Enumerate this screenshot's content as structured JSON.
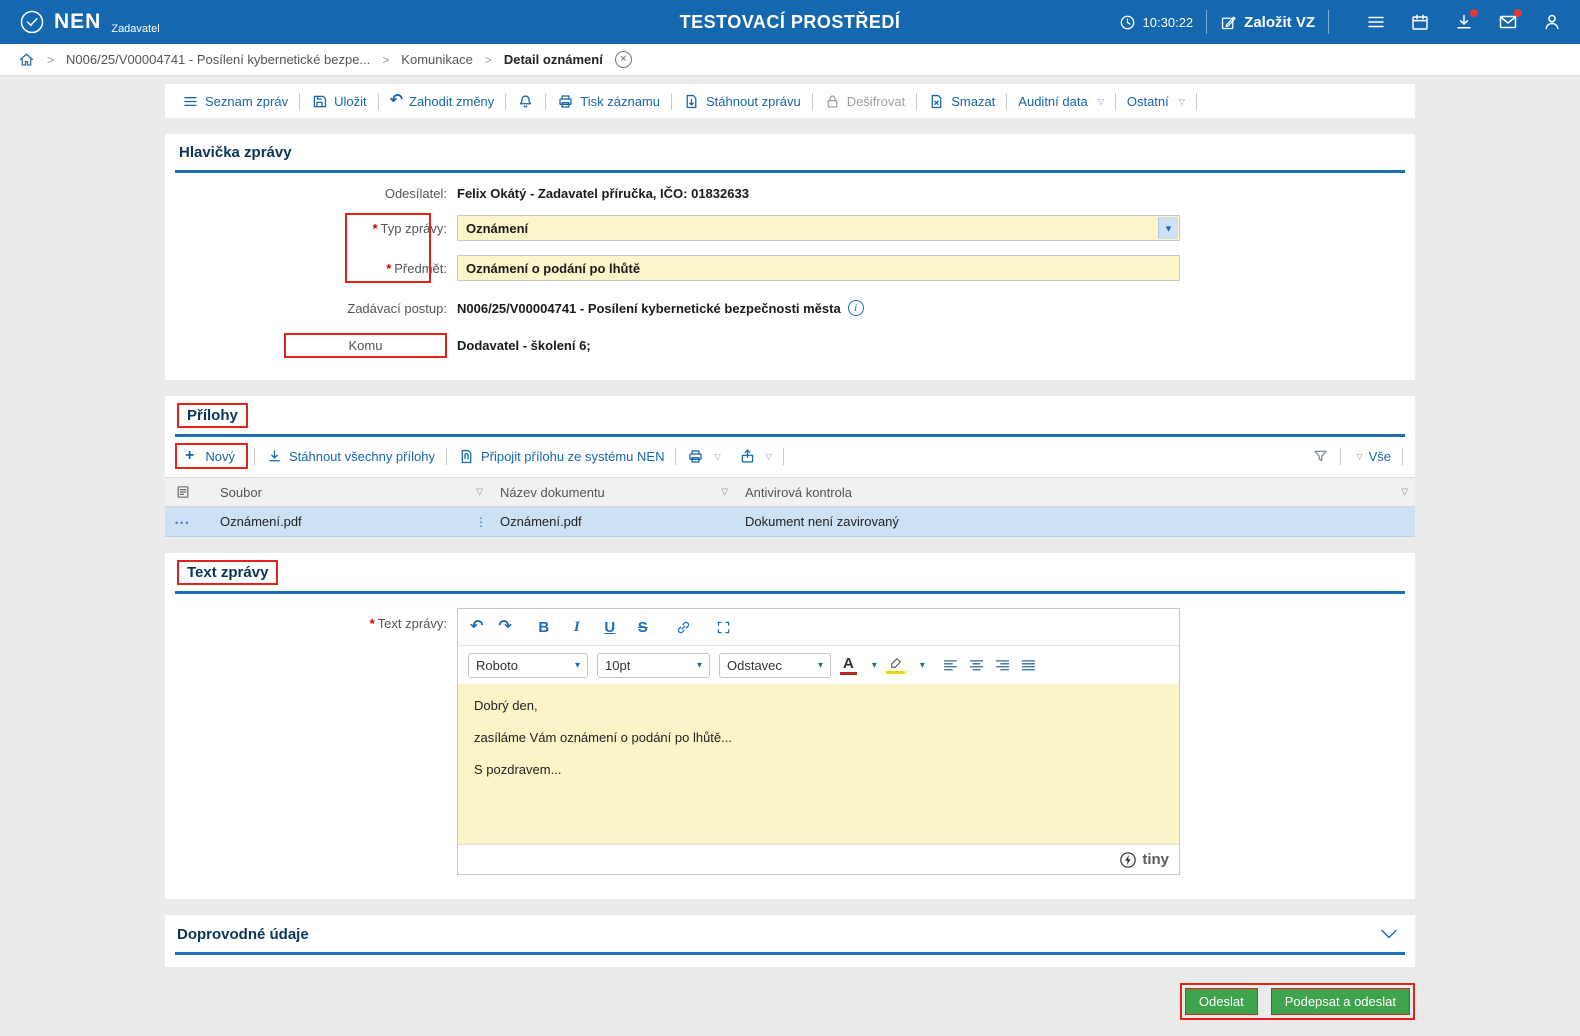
{
  "marks": {
    "required": "*"
  },
  "icons": {
    "caret_down": "▾",
    "filter_triangle": "▽",
    "breadcrumb_sep": ">",
    "plus": "+",
    "close": "×",
    "info": "i",
    "row_menu_dots": "•••",
    "col_handle": "⋮",
    "undo": "↶",
    "redo": "↷"
  },
  "topbar": {
    "logo_text": "NEN",
    "logo_subtitle": "Zadavatel",
    "env_title": "TESTOVACÍ PROSTŘEDÍ",
    "time": "10:30:22",
    "create_button": "Založit VZ"
  },
  "breadcrumb": {
    "items": [
      "N006/25/V00004741 - Posílení kybernetické bezpe...",
      "Komunikace",
      "Detail oznámení"
    ]
  },
  "toolbar": {
    "items": {
      "seznam": "Seznam zpráv",
      "ulozit": "Uložit",
      "zahodit": "Zahodit změny",
      "tisk": "Tisk záznamu",
      "stahnout": "Stáhnout zprávu",
      "desifrovat": "Dešifrovat",
      "smazat": "Smazat",
      "auditni": "Auditní data",
      "ostatni": "Ostatní"
    }
  },
  "hlavicka": {
    "title": "Hlavička zprávy",
    "odesilatel_label": "Odesílatel:",
    "odesilatel_value": "Felix Okátý - Zadavatel příručka, IČO: 01832633",
    "typ_label": "Typ zprávy:",
    "typ_value": "Oznámení",
    "predmet_label": "Předmět:",
    "predmet_value": "Oznámení o podání po lhůtě",
    "postup_label": "Zadávací postup:",
    "postup_value": "N006/25/V00004741 - Posílení kybernetické bezpečnosti města",
    "komu_label": "Komu",
    "komu_value": "Dodavatel - školení 6;"
  },
  "prilohy": {
    "title": "Přílohy",
    "novy": "Nový",
    "stahnout_vse": "Stáhnout všechny přílohy",
    "pripojit": "Připojit přílohu ze systému NEN",
    "vse": "Vše",
    "columns": [
      "Soubor",
      "Název dokumentu",
      "Antivirová kontrola"
    ],
    "rows": [
      {
        "soubor": "Oznámení.pdf",
        "nazev": "Oznámení.pdf",
        "antivir": "Dokument není zavirovaný"
      }
    ]
  },
  "text_zpravy": {
    "title": "Text zprávy",
    "label": "Text zprávy:",
    "toolbar": {
      "bold": "B",
      "italic": "I",
      "underline": "U",
      "strike": "S",
      "font_name": "Roboto",
      "font_size": "10pt",
      "block_style": "Odstavec",
      "color_letter": "A"
    },
    "paragraphs": [
      "Dobrý den,",
      "zasíláme Vám oznámení o podání po lhůtě...",
      "S pozdravem..."
    ],
    "branding": "tiny"
  },
  "doprovodne": {
    "title": "Doprovodné údaje"
  },
  "actions": {
    "odeslat": "Odeslat",
    "podepsat": "Podepsat a odeslat"
  }
}
